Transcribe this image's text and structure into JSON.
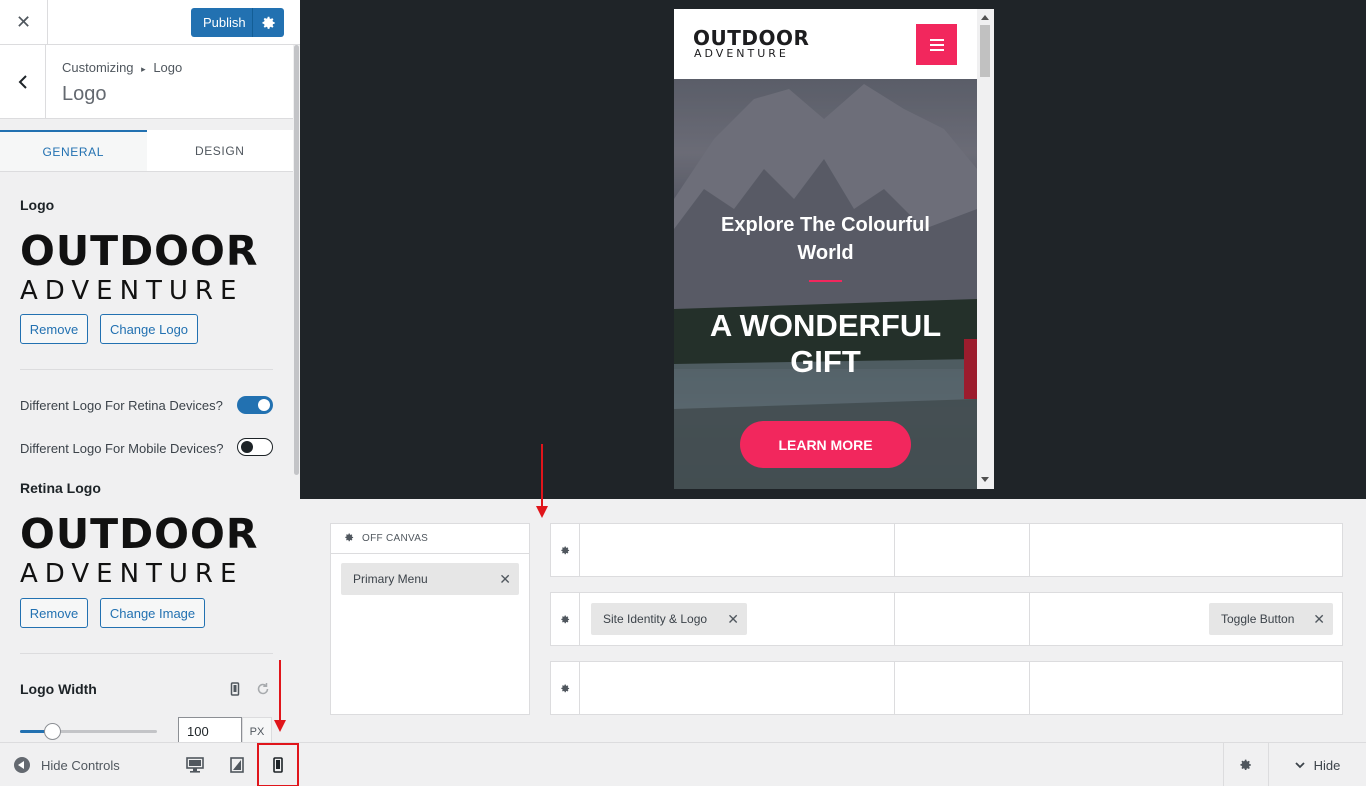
{
  "topbar": {
    "close_icon": "close-icon",
    "publish_label": "Publish",
    "publish_settings_icon": "gear-icon"
  },
  "section": {
    "breadcrumb_root": "Customizing",
    "breadcrumb_sep": "▸",
    "breadcrumb_current": "Logo",
    "title": "Logo"
  },
  "tabs": [
    {
      "label": "GENERAL",
      "active": true
    },
    {
      "label": "DESIGN",
      "active": false
    }
  ],
  "logo_control": {
    "label": "Logo",
    "logo_line1": "OUTDOOR",
    "logo_line2": "ADVENTURE",
    "remove_label": "Remove",
    "change_label": "Change Logo"
  },
  "toggles": [
    {
      "label": "Different Logo For Retina Devices?",
      "on": true
    },
    {
      "label": "Different Logo For Mobile Devices?",
      "on": false
    }
  ],
  "retina_control": {
    "label": "Retina Logo",
    "logo_line1": "OUTDOOR",
    "logo_line2": "ADVENTURE",
    "remove_label": "Remove",
    "change_label": "Change Image"
  },
  "logo_width": {
    "label": "Logo Width",
    "value": "100",
    "unit": "PX",
    "slider_fraction": 0.23
  },
  "footer": {
    "hide_controls_label": "Hide Controls",
    "hide_label": "Hide",
    "active_device": "mobile"
  },
  "preview": {
    "site_logo_line1": "OUTDOOR",
    "site_logo_line2": "ADVENTURE",
    "hero_subtitle": "Explore The Colourful World",
    "hero_title": "A WONDERFUL GIFT",
    "hero_button": "LEARN MORE",
    "accent_color": "#f2275d"
  },
  "builder": {
    "offcanvas_label": "OFF CANVAS",
    "offcanvas_items": [
      "Primary Menu"
    ],
    "middle_row_left": "Site Identity & Logo",
    "middle_row_right": "Toggle Button"
  },
  "colors": {
    "wp_blue": "#2271b1",
    "annotation_red": "#e0151b",
    "preview_bg": "#1f2428"
  }
}
